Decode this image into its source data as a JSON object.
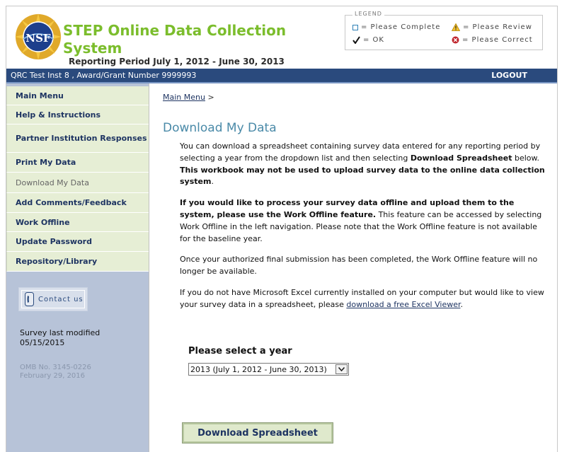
{
  "header": {
    "logo_text": "NSF",
    "title_line1": "STEP Online Data Collection",
    "title_line2": "System",
    "reporting_period": "Reporting Period July 1, 2012 - June 30, 2013"
  },
  "legend": {
    "title": "LEGEND",
    "complete": "= Please Complete",
    "ok": "= OK",
    "review": "= Please Review",
    "correct": "= Please Correct"
  },
  "topbar": {
    "institution": "QRC Test Inst 8 , Award/Grant Number 9999993",
    "logout": "LOGOUT"
  },
  "sidebar": {
    "items": [
      {
        "label": "Main Menu",
        "current": false
      },
      {
        "label": "Help & Instructions",
        "current": false
      },
      {
        "label": "Partner Institution Responses",
        "current": false
      },
      {
        "label": "Print My Data",
        "current": false
      },
      {
        "label": "Download My Data",
        "current": true
      },
      {
        "label": "Add Comments/Feedback",
        "current": false
      },
      {
        "label": "Work Offline",
        "current": false
      },
      {
        "label": "Update Password",
        "current": false
      },
      {
        "label": "Repository/Library",
        "current": false
      }
    ],
    "contact": "Contact us",
    "modified_label": "Survey last modified",
    "modified_date": "05/15/2015",
    "omb_no": "OMB No. 3145-0226",
    "omb_date": "February 29, 2016"
  },
  "main": {
    "breadcrumb_link": "Main Menu",
    "breadcrumb_sep": ">",
    "title": "Download My Data",
    "p1_a": "You can download a spreadsheet containing survey data entered for any reporting period by selecting a year from the dropdown list and then selecting ",
    "p1_b": "Download Spreadsheet",
    "p1_c": " below. ",
    "p1_d": "This workbook may not be used to upload survey data to the online data collection system",
    "p1_e": ".",
    "p2_a": "If you would like to process your survey data offline and upload them to the system, please use the Work Offline feature.",
    "p2_b": " This feature can be accessed by selecting Work Offline in the left navigation. Please note that the Work Offline feature is not available for the baseline year.",
    "p3": "Once your authorized final submission has been completed, the Work Offline feature will no longer be available.",
    "p4_a": "If you do not have Microsoft Excel currently installed on your computer but would like to view your survey data in a spreadsheet, please ",
    "p4_link": "download a free Excel Viewer",
    "p4_b": ".",
    "select_label": "Please select a year",
    "selected_year": "2013 (July 1, 2012 - June 30, 2013)",
    "download_button": "Download Spreadsheet"
  },
  "colors": {
    "brand_green": "#7bbd2c",
    "bar_blue": "#2a4a7d",
    "title_teal": "#4a8aa8",
    "nav_bg": "#e6eed5"
  }
}
